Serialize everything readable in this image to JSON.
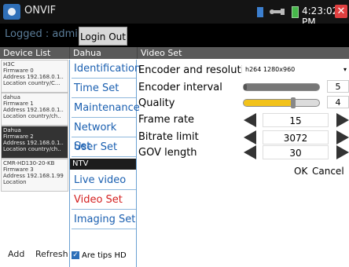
{
  "status": {
    "app_title": "ONVIF",
    "time": "4:23:02 PM"
  },
  "header": {
    "logged": "Logged : admin",
    "logout_label": "Login Out"
  },
  "columns": {
    "device_list": "Device List",
    "vendor": "Dahua",
    "section": "Video Set"
  },
  "devices": [
    {
      "lines": [
        "H3C",
        "Firmware 0",
        "Address 192.168.0.1..",
        "Location country/C..."
      ]
    },
    {
      "lines": [
        "dahua",
        "Firmware 1",
        "Address 192.168.0.1..",
        "Location country/ch.."
      ]
    },
    {
      "lines": [
        "Dahua",
        "Firmware 2",
        "Address 192.168.0.1..",
        "Location country/ch.."
      ]
    },
    {
      "lines": [
        "CMR-HD130-20-KB",
        "Firmware 3",
        "Address 192.168.1.99",
        "Location"
      ]
    }
  ],
  "footer": {
    "add": "Add",
    "refresh": "Refresh",
    "tips": "Are tips HD"
  },
  "menu": {
    "items": [
      "Identification",
      "Time Set",
      "Maintenance",
      "Network Set",
      "User Set"
    ],
    "ntv_header": "NTV",
    "ntv_items": [
      "Live video",
      "Video Set",
      "Imaging Set"
    ]
  },
  "settings": {
    "encoder_resolution": {
      "label": "Encoder and resolution",
      "value": "h264 1280x960"
    },
    "encoder_interval": {
      "label": "Encoder interval",
      "value": "5"
    },
    "quality": {
      "label": "Quality",
      "value": "4"
    },
    "frame_rate": {
      "label": "Frame rate",
      "value": "15"
    },
    "bitrate_limit": {
      "label": "Bitrate limit",
      "value": "3072"
    },
    "gov_length": {
      "label": "GOV length",
      "value": "30"
    }
  },
  "actions": {
    "ok": "OK",
    "cancel": "Cancel"
  },
  "colors": {
    "accent_blue": "#1a5fb0",
    "active_red": "#d42020",
    "quality_yellow": "#f2c21a"
  }
}
